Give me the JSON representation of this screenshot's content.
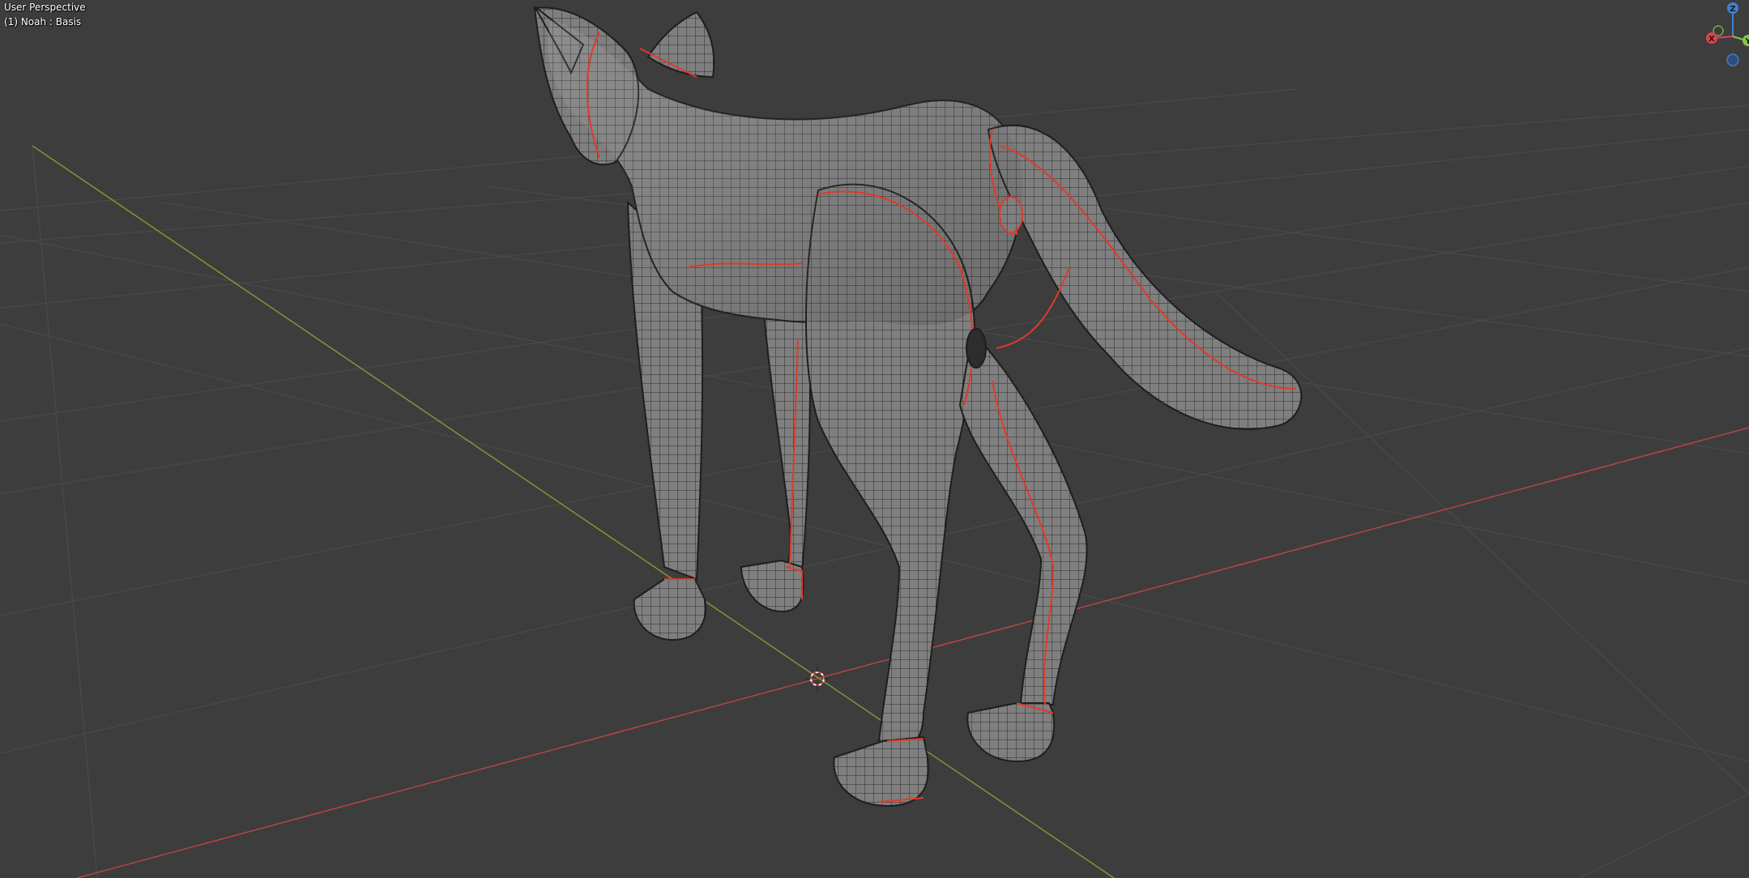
{
  "viewport": {
    "view_name": "User Perspective",
    "object_info": "(1) Noah : Basis",
    "background_color": "#3d3d3d",
    "grid_color": "#4a4a4a",
    "x_axis_color": "#c84a4a",
    "y_axis_color": "#7da33a",
    "seam_color": "#e03a2a",
    "mesh_color": "#8a8a8a",
    "wire_color": "#2a2a2a"
  },
  "navigation_gizmo": {
    "x_label": "X",
    "y_label": "Y",
    "z_label": "Z",
    "x_color": "#e0424f",
    "y_color": "#8bc34a",
    "z_color": "#3b82d6"
  },
  "model": {
    "icon": "wolf-mesh"
  }
}
